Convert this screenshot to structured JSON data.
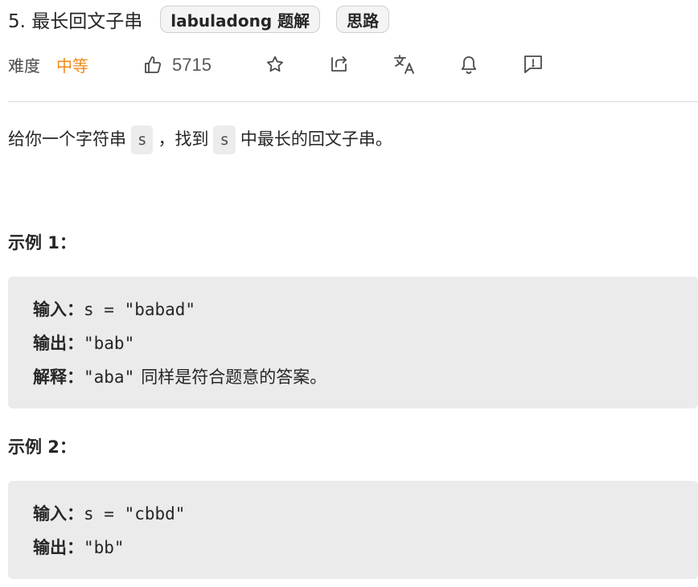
{
  "problem": {
    "title": "5. 最长回文子串",
    "tags": [
      "labuladong 题解",
      "思路"
    ]
  },
  "meta": {
    "difficulty_label": "难度",
    "difficulty_value": "中等",
    "like_count": "5715",
    "colors": {
      "difficulty": "#ef8a1a"
    },
    "icons": [
      "thumbs-up-icon",
      "star-icon",
      "share-icon",
      "translate-icon",
      "bell-icon",
      "feedback-icon"
    ]
  },
  "description": {
    "part1": "给你一个字符串",
    "code1": "s",
    "part2": "，找到",
    "code2": "s",
    "part3": "中最长的回文子串。"
  },
  "examples": [
    {
      "title": "示例 1：",
      "input_label": "输入：",
      "input_value": "s = \"babad\"",
      "output_label": "输出：",
      "output_value": "\"bab\"",
      "explain_label": "解释：",
      "explain_code": "\"aba\"",
      "explain_text": "同样是符合题意的答案。"
    },
    {
      "title": "示例 2：",
      "input_label": "输入：",
      "input_value": "s = \"cbbd\"",
      "output_label": "输出：",
      "output_value": "\"bb\""
    }
  ]
}
